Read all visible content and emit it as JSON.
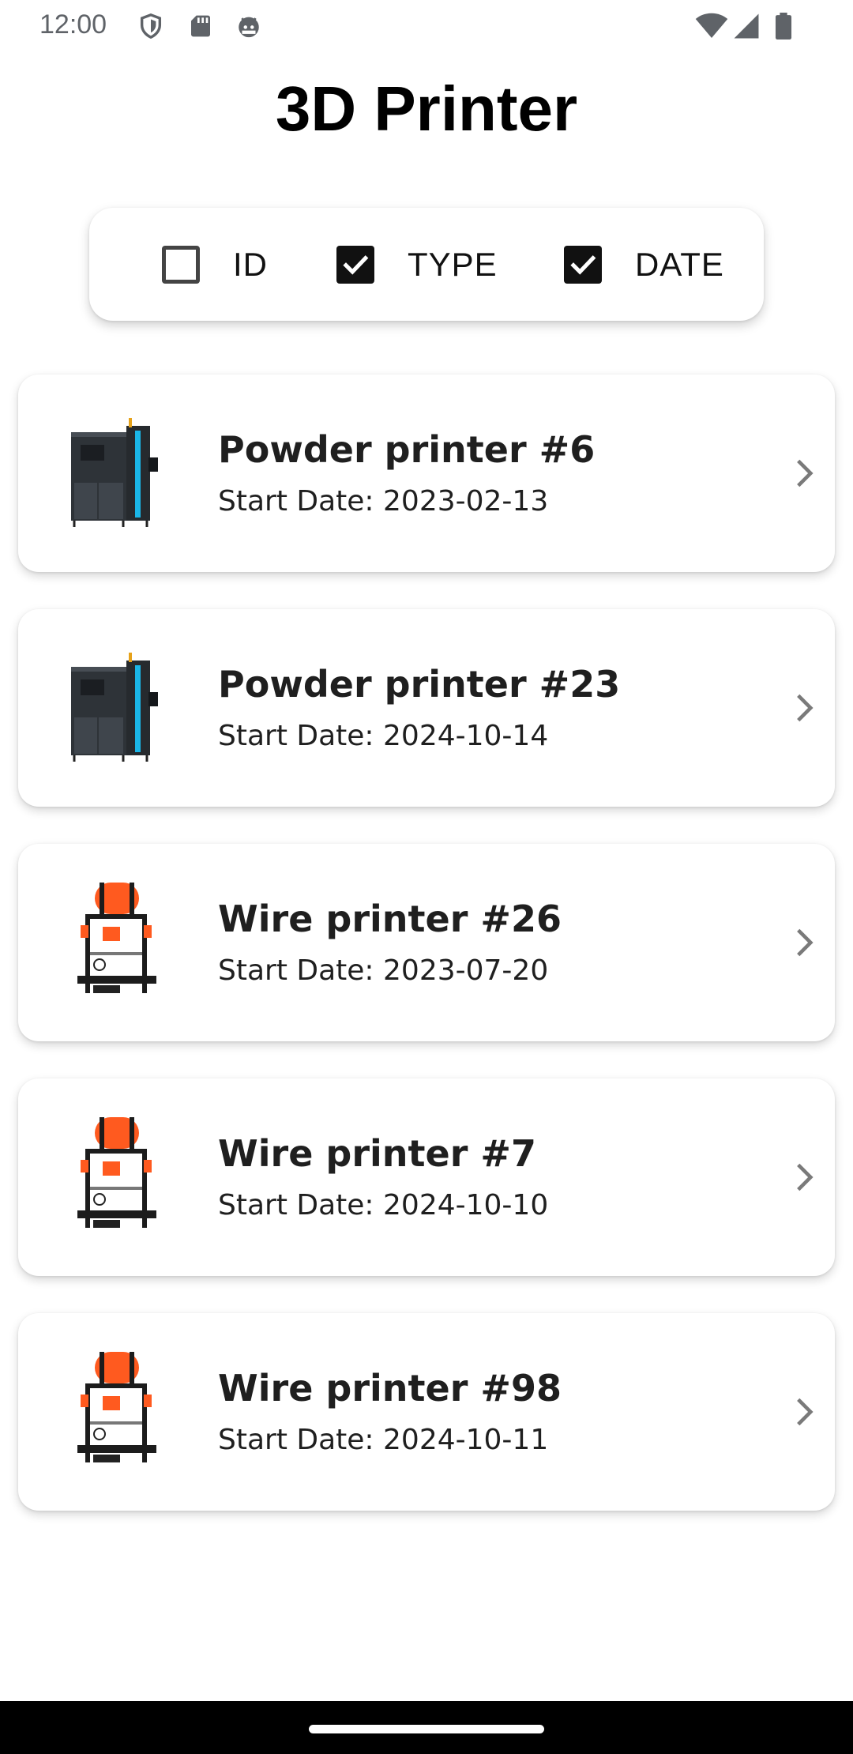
{
  "status_bar": {
    "time": "12:00",
    "icons_left": [
      "shield-icon",
      "sd-card-icon",
      "android-debug-icon"
    ],
    "icons_right": [
      "wifi-icon",
      "signal-icon",
      "battery-icon"
    ]
  },
  "header": {
    "title": "3D Printer"
  },
  "filters": [
    {
      "label": "ID",
      "checked": false
    },
    {
      "label": "TYPE",
      "checked": true
    },
    {
      "label": "DATE",
      "checked": true
    }
  ],
  "printers": [
    {
      "name": "Powder printer #6",
      "date_text": "Start Date: 2023-02-13",
      "kind": "powder"
    },
    {
      "name": "Powder printer #23",
      "date_text": "Start Date: 2024-10-14",
      "kind": "powder"
    },
    {
      "name": "Wire printer #26",
      "date_text": "Start Date: 2023-07-20",
      "kind": "wire"
    },
    {
      "name": "Wire printer #7",
      "date_text": "Start Date: 2024-10-10",
      "kind": "wire"
    },
    {
      "name": "Wire printer #98",
      "date_text": "Start Date: 2024-10-11",
      "kind": "wire"
    }
  ],
  "colors": {
    "accent_filament": "#ff5a1f",
    "accent_blue": "#1ab6e8",
    "text": "#1f1f1f"
  }
}
